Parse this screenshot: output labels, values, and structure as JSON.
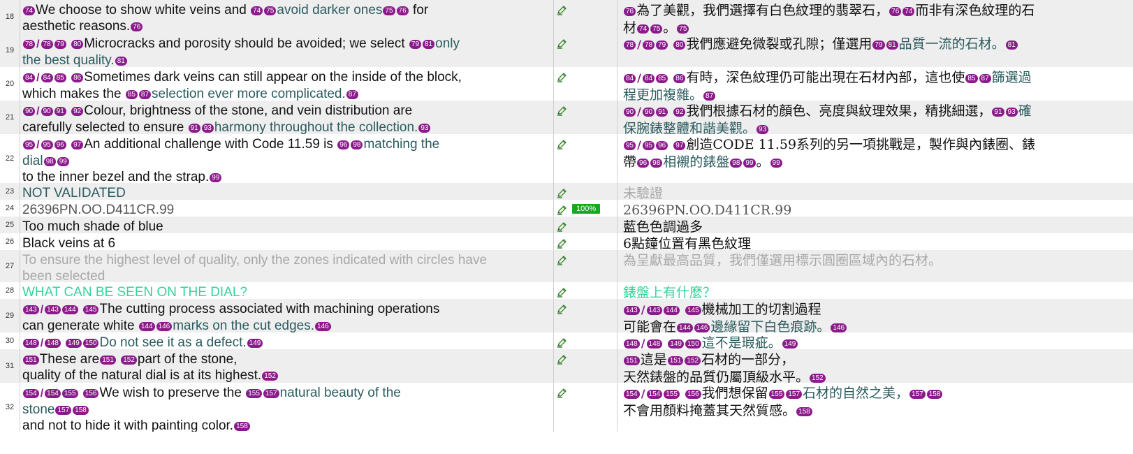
{
  "colors": {
    "tag_bg": "#8b1a8b",
    "alt_row": "#eeeeee",
    "teal_text": "#2b5b5e",
    "grey_text": "#a8a8a8",
    "green_text": "#34d39a",
    "match_badge": "#17a91f"
  },
  "icons": {
    "status": "pencil-edit-icon"
  },
  "rows": [
    {
      "num": "18",
      "h": 48,
      "bg": "alt",
      "source": [
        [
          "t",
          "74"
        ],
        [
          "x",
          "We choose to show white veins and "
        ],
        [
          "t",
          "74"
        ],
        [
          "t",
          "75"
        ],
        [
          "x",
          "avoid darker ones",
          "teal"
        ],
        [
          "t",
          "75"
        ],
        [
          "t",
          "76"
        ],
        [
          "x",
          " for\naesthetic reasons."
        ],
        [
          "t",
          "76"
        ]
      ],
      "target": [
        [
          "t",
          "76"
        ],
        [
          "x",
          "為了美觀，我們選擇有白色紋理的翡翠石，"
        ],
        [
          "t",
          "76"
        ],
        [
          "t",
          "74"
        ],
        [
          "x",
          "而非有深色紋理的石\n材"
        ],
        [
          "t",
          "74"
        ],
        [
          "t",
          "75"
        ],
        [
          "x",
          "。"
        ],
        [
          "t",
          "75"
        ]
      ]
    },
    {
      "num": "19",
      "h": 48,
      "bg": "alt",
      "source": [
        [
          "t",
          "78"
        ],
        [
          "s",
          "/"
        ],
        [
          "t",
          "78"
        ],
        [
          "t",
          "79"
        ],
        [
          "x",
          " "
        ],
        [
          "t",
          "80"
        ],
        [
          "x",
          "Microcracks and porosity should be avoided; we select "
        ],
        [
          "t",
          "79"
        ],
        [
          "t",
          "81"
        ],
        [
          "x",
          "only\nthe best quality.",
          "teal"
        ],
        [
          "t",
          "81"
        ]
      ],
      "target": [
        [
          "t",
          "78"
        ],
        [
          "s",
          "/"
        ],
        [
          "t",
          "78"
        ],
        [
          "t",
          "79"
        ],
        [
          "x",
          " "
        ],
        [
          "t",
          "80"
        ],
        [
          "x",
          "我們應避免微裂或孔隙；僅選用"
        ],
        [
          "t",
          "79"
        ],
        [
          "t",
          "81"
        ],
        [
          "x",
          "品質一流的石材。",
          "teal"
        ],
        [
          "t",
          "81"
        ]
      ]
    },
    {
      "num": "20",
      "h": 48,
      "bg": "plain",
      "source": [
        [
          "t",
          "84"
        ],
        [
          "s",
          "/"
        ],
        [
          "t",
          "84"
        ],
        [
          "t",
          "85"
        ],
        [
          "x",
          " "
        ],
        [
          "t",
          "86"
        ],
        [
          "x",
          "Sometimes dark veins can still appear on the inside of the block,\nwhich makes the "
        ],
        [
          "t",
          "85"
        ],
        [
          "t",
          "87"
        ],
        [
          "x",
          "selection ever more complicated.",
          "teal"
        ],
        [
          "t",
          "87"
        ]
      ],
      "target": [
        [
          "t",
          "84"
        ],
        [
          "s",
          "/"
        ],
        [
          "t",
          "84"
        ],
        [
          "t",
          "85"
        ],
        [
          "x",
          " "
        ],
        [
          "t",
          "86"
        ],
        [
          "x",
          "有時，深色紋理仍可能出現在石材內部，這也使"
        ],
        [
          "t",
          "85"
        ],
        [
          "t",
          "87"
        ],
        [
          "x",
          "篩選過\n程更加複雜。",
          "teal"
        ],
        [
          "t",
          "87"
        ]
      ]
    },
    {
      "num": "21",
      "h": 48,
      "bg": "alt",
      "source": [
        [
          "t",
          "90"
        ],
        [
          "s",
          "/"
        ],
        [
          "t",
          "90"
        ],
        [
          "t",
          "91"
        ],
        [
          "x",
          " "
        ],
        [
          "t",
          "92"
        ],
        [
          "x",
          "Colour, brightness of the stone, and vein distribution are\ncarefully selected to ensure "
        ],
        [
          "t",
          "91"
        ],
        [
          "t",
          "93"
        ],
        [
          "x",
          "harmony throughout the collection.",
          "teal"
        ],
        [
          "t",
          "93"
        ]
      ],
      "target": [
        [
          "t",
          "90"
        ],
        [
          "s",
          "/"
        ],
        [
          "t",
          "90"
        ],
        [
          "t",
          "91"
        ],
        [
          "x",
          " "
        ],
        [
          "t",
          "92"
        ],
        [
          "x",
          "我們根據石材的顏色、亮度與紋理效果，精挑細選，"
        ],
        [
          "t",
          "91"
        ],
        [
          "t",
          "93"
        ],
        [
          "x",
          "確\n保腕錶整體和諧美觀。",
          "teal"
        ],
        [
          "t",
          "93"
        ]
      ]
    },
    {
      "num": "22",
      "h": 70,
      "bg": "plain",
      "source": [
        [
          "t",
          "95"
        ],
        [
          "s",
          "/"
        ],
        [
          "t",
          "95"
        ],
        [
          "t",
          "96"
        ],
        [
          "x",
          " "
        ],
        [
          "t",
          "97"
        ],
        [
          "x",
          "An additional challenge with Code 11.59 is "
        ],
        [
          "t",
          "96"
        ],
        [
          "t",
          "98"
        ],
        [
          "x",
          "matching the\ndial",
          "teal"
        ],
        [
          "t",
          "98"
        ],
        [
          "t",
          "99"
        ],
        [
          "x",
          "\nto the inner bezel and the strap."
        ],
        [
          "t",
          "99"
        ]
      ],
      "target": [
        [
          "t",
          "95"
        ],
        [
          "s",
          "/"
        ],
        [
          "t",
          "95"
        ],
        [
          "t",
          "96"
        ],
        [
          "x",
          " "
        ],
        [
          "t",
          "97"
        ],
        [
          "x",
          "創造CODE 11.59系列的另一項挑戰是，製作與內錶圈、錶\n帶"
        ],
        [
          "t",
          "96"
        ],
        [
          "t",
          "98"
        ],
        [
          "x",
          "相襯的錶盤",
          "teal"
        ],
        [
          "t",
          "98"
        ],
        [
          "t",
          "99"
        ],
        [
          "x",
          "。"
        ],
        [
          "t",
          "99"
        ]
      ]
    },
    {
      "num": "23",
      "h": 24,
      "bg": "alt",
      "source": [
        [
          "x",
          "NOT VALIDATED",
          "teal"
        ]
      ],
      "target": [
        [
          "x",
          "未驗證",
          "grey"
        ]
      ]
    },
    {
      "num": "24",
      "h": 24,
      "bg": "plain",
      "badge": "100%",
      "source": [
        [
          "x",
          "26396PN.OO.D411CR.99",
          "hash"
        ]
      ],
      "target": [
        [
          "x",
          "26396PN.OO.D411CR.99",
          "hash"
        ]
      ]
    },
    {
      "num": "25",
      "h": 24,
      "bg": "alt",
      "source": [
        [
          "x",
          "Too much shade of blue"
        ]
      ],
      "target": [
        [
          "x",
          "藍色色調過多"
        ]
      ]
    },
    {
      "num": "26",
      "h": 24,
      "bg": "plain",
      "source": [
        [
          "x",
          "Black veins at 6"
        ]
      ],
      "target": [
        [
          "x",
          "6點鐘位置有黑色紋理"
        ]
      ]
    },
    {
      "num": "27",
      "h": 46,
      "bg": "alt",
      "source": [
        [
          "x",
          "To ensure the highest level of quality, only the zones indicated with circles have\nbeen selected",
          "grey"
        ]
      ],
      "target": [
        [
          "x",
          "為呈獻最高品質，我們僅選用標示圓圈區域內的石材。",
          "grey"
        ]
      ]
    },
    {
      "num": "28",
      "h": 24,
      "bg": "plain",
      "source": [
        [
          "x",
          "WHAT CAN BE SEEN ON THE DIAL?",
          "green"
        ]
      ],
      "target": [
        [
          "x",
          "錶盤上有什麼？",
          "green"
        ]
      ]
    },
    {
      "num": "29",
      "h": 48,
      "bg": "alt",
      "source": [
        [
          "t",
          "143"
        ],
        [
          "s",
          "/"
        ],
        [
          "t",
          "143"
        ],
        [
          "t",
          "144"
        ],
        [
          "x",
          " "
        ],
        [
          "t",
          "145"
        ],
        [
          "x",
          "The cutting process associated with machining operations\ncan generate white "
        ],
        [
          "t",
          "144"
        ],
        [
          "t",
          "146"
        ],
        [
          "x",
          "marks on the cut edges.",
          "teal"
        ],
        [
          "t",
          "146"
        ]
      ],
      "target": [
        [
          "t",
          "143"
        ],
        [
          "s",
          "/"
        ],
        [
          "t",
          "143"
        ],
        [
          "t",
          "144"
        ],
        [
          "x",
          " "
        ],
        [
          "t",
          "145"
        ],
        [
          "x",
          "機械加工的切割過程\n可能會在"
        ],
        [
          "t",
          "144"
        ],
        [
          "t",
          "146"
        ],
        [
          "x",
          "邊緣留下白色痕跡。",
          "teal"
        ],
        [
          "t",
          "146"
        ]
      ]
    },
    {
      "num": "30",
      "h": 24,
      "bg": "plain",
      "source": [
        [
          "t",
          "148"
        ],
        [
          "s",
          "/"
        ],
        [
          "t",
          "148"
        ],
        [
          "x",
          " "
        ],
        [
          "t",
          "149"
        ],
        [
          "t",
          "150"
        ],
        [
          "x",
          "Do not see it as a defect.",
          "teal"
        ],
        [
          "t",
          "149"
        ]
      ],
      "target": [
        [
          "t",
          "148"
        ],
        [
          "s",
          "/"
        ],
        [
          "t",
          "148"
        ],
        [
          "x",
          " "
        ],
        [
          "t",
          "149"
        ],
        [
          "t",
          "150"
        ],
        [
          "x",
          "這不是瑕疵。",
          "teal"
        ],
        [
          "t",
          "149"
        ]
      ]
    },
    {
      "num": "31",
      "h": 48,
      "bg": "alt",
      "source": [
        [
          "t",
          "151"
        ],
        [
          "x",
          "These are"
        ],
        [
          "t",
          "151"
        ],
        [
          "x",
          " "
        ],
        [
          "t",
          "152"
        ],
        [
          "x",
          "part of the stone,\nquality of the natural dial is at its highest."
        ],
        [
          "t",
          "152"
        ]
      ],
      "target": [
        [
          "t",
          "151"
        ],
        [
          "x",
          "這是"
        ],
        [
          "t",
          "151"
        ],
        [
          "t",
          "152"
        ],
        [
          "x",
          "石材的一部分，\n天然錶盤的品質仍屬頂級水平。"
        ],
        [
          "t",
          "152"
        ]
      ]
    },
    {
      "num": "32",
      "h": 70,
      "bg": "plain",
      "source": [
        [
          "t",
          "154"
        ],
        [
          "s",
          "/"
        ],
        [
          "t",
          "154"
        ],
        [
          "t",
          "155"
        ],
        [
          "x",
          " "
        ],
        [
          "t",
          "156"
        ],
        [
          "x",
          "We wish to preserve the "
        ],
        [
          "t",
          "155"
        ],
        [
          "t",
          "157"
        ],
        [
          "x",
          "natural beauty of the\nstone",
          "teal"
        ],
        [
          "t",
          "157"
        ],
        [
          "t",
          "158"
        ],
        [
          "x",
          "\nand not to hide it with painting color."
        ],
        [
          "t",
          "158"
        ]
      ],
      "target": [
        [
          "t",
          "154"
        ],
        [
          "s",
          "/"
        ],
        [
          "t",
          "154"
        ],
        [
          "t",
          "155"
        ],
        [
          "x",
          " "
        ],
        [
          "t",
          "156"
        ],
        [
          "x",
          "我們想保留"
        ],
        [
          "t",
          "155"
        ],
        [
          "t",
          "157"
        ],
        [
          "x",
          "石材的自然之美，",
          "teal"
        ],
        [
          "t",
          "157"
        ],
        [
          "t",
          "158"
        ],
        [
          "x",
          "\n不會用顏料掩蓋其天然質感。"
        ],
        [
          "t",
          "158"
        ]
      ]
    }
  ]
}
